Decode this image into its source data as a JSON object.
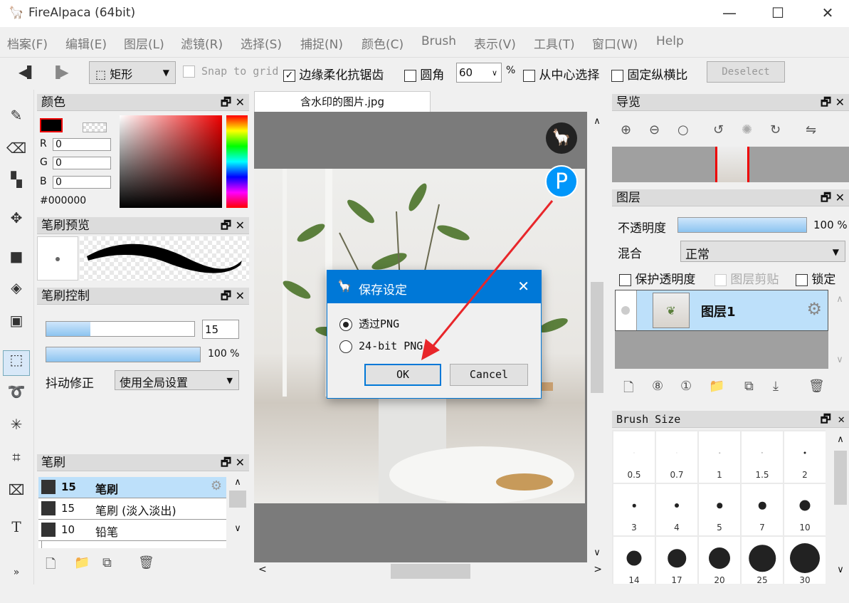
{
  "window": {
    "title": "FireAlpaca (64bit)",
    "minimize": "—",
    "maximize": "☐",
    "close": "✕"
  },
  "menu": [
    "档案(F)",
    "编辑(E)",
    "图层(L)",
    "滤镜(R)",
    "选择(S)",
    "捕捉(N)",
    "颜色(C)",
    "Brush",
    "表示(V)",
    "工具(T)",
    "窗口(W)",
    "Help"
  ],
  "toolbar": {
    "shape": "矩形",
    "snap": "Snap to grid",
    "antialias": "边缘柔化抗锯齿",
    "round": "圆角",
    "round_value": "60",
    "percent": "%",
    "from_center": "从中心选择",
    "fixed_ratio": "固定纵横比",
    "deselect": "Deselect"
  },
  "color_panel": {
    "title": "颜色",
    "r_label": "R",
    "g_label": "G",
    "b_label": "B",
    "r": "0",
    "g": "0",
    "b": "0",
    "hex": "#000000",
    "primary": "#000000"
  },
  "brush_preview": {
    "title": "笔刷预览"
  },
  "brush_control": {
    "title": "笔刷控制",
    "size": "15",
    "size_fraction": 0.3,
    "opacity": "100 %",
    "stabilizer_label": "抖动修正",
    "stabilizer": "使用全局设置"
  },
  "brush_panel": {
    "title": "笔刷",
    "items": [
      {
        "size": "15",
        "name": "笔刷"
      },
      {
        "size": "15",
        "name": "笔刷 (淡入淡出)"
      },
      {
        "size": "10",
        "name": "铅笔"
      }
    ]
  },
  "canvas": {
    "tab": "含水印的图片.jpg"
  },
  "navigator": {
    "title": "导览"
  },
  "layers": {
    "title": "图层",
    "opacity_label": "不透明度",
    "opacity": "100 %",
    "blend_label": "混合",
    "blend": "正常",
    "protect": "保护透明度",
    "clip": "图层剪贴",
    "lock": "锁定",
    "layer_name": "图层1"
  },
  "brush_size": {
    "title": "Brush Size",
    "sizes": [
      "0.5",
      "0.7",
      "1",
      "1.5",
      "2",
      "3",
      "4",
      "5",
      "7",
      "10",
      "14",
      "17",
      "20",
      "25",
      "30"
    ]
  },
  "dialog": {
    "title": "保存设定",
    "option1": "透过PNG",
    "option2": "24-bit PNG",
    "ok": "OK",
    "cancel": "Cancel",
    "close": "✕"
  },
  "colors": {
    "accent": "#0078d7",
    "selection": "#bde0fa"
  }
}
